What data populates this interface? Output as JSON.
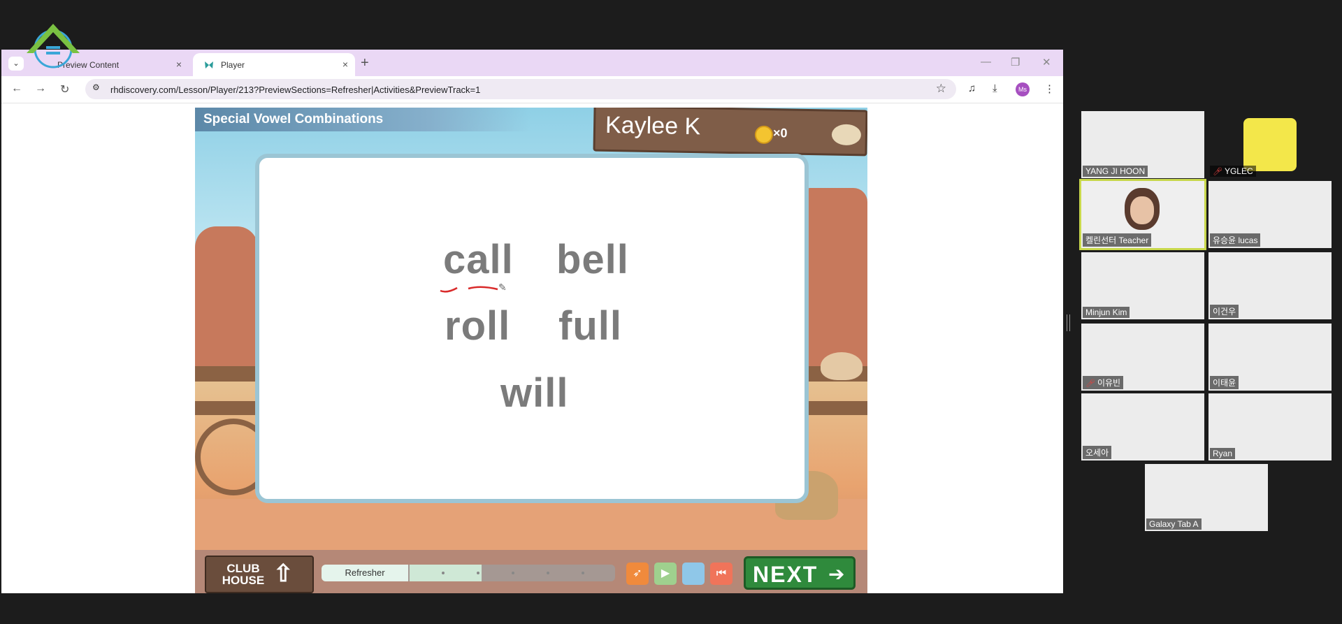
{
  "browser": {
    "tabs": [
      {
        "title": "Preview Content",
        "close": "×"
      },
      {
        "title": "Player",
        "close": "×"
      }
    ],
    "new_tab": "+",
    "window_controls": {
      "minimize": "—",
      "restore": "❐",
      "close": "✕"
    },
    "url": "rhdiscovery.com/Lesson/Player/213?PreviewSections=Refresher|Activities&PreviewTrack=1",
    "profile_initials": "Ms"
  },
  "game": {
    "lesson_title": "Special Vowel Combinations",
    "student_name": "Kaylee K",
    "coin_count": "×0",
    "words": [
      "call",
      "bell",
      "roll",
      "full",
      "will"
    ],
    "club_house_label": "CLUB HOUSE",
    "progress_label": "Refresher",
    "progress_fraction": 0.35,
    "next_label": "NEXT"
  },
  "participants": [
    {
      "name": "YANG JI HOON",
      "muted": false
    },
    {
      "name": "YGLEC",
      "muted": true
    },
    {
      "name": "켈린선터 Teacher",
      "muted": false
    },
    {
      "name": "유승윤 lucas",
      "muted": false
    },
    {
      "name": "Minjun Kim",
      "muted": false
    },
    {
      "name": "이건우",
      "muted": false
    },
    {
      "name": "이유빈",
      "muted": true
    },
    {
      "name": "이태윤",
      "muted": false
    },
    {
      "name": "오세아",
      "muted": false
    },
    {
      "name": "Ryan",
      "muted": false
    },
    {
      "name": "Galaxy Tab A",
      "muted": false
    }
  ],
  "colors": {
    "tabstrip": "#ead8f5",
    "teacher_highlight": "#c8d84b",
    "mic_muted": "#e0413f",
    "next_button": "#2f8a3c"
  },
  "icons": [
    "logo-icon",
    "tab-search-icon",
    "back-icon",
    "forward-icon",
    "reload-icon",
    "site-info-icon",
    "star-icon",
    "media-icon",
    "download-icon",
    "menu-icon",
    "coin-icon",
    "hat-icon",
    "house-icon",
    "bird-icon",
    "play-icon",
    "stop-icon",
    "rewind-icon",
    "next-arrow-icon",
    "pen-cursor-icon",
    "mic-muted-icon"
  ]
}
